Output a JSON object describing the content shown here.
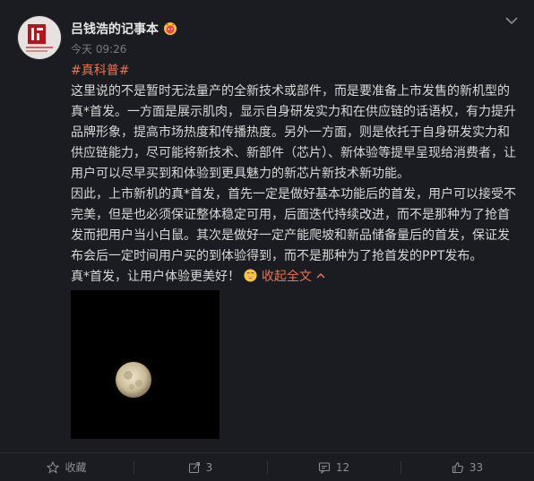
{
  "post": {
    "author": "吕钱浩的记事本",
    "time": "今天 09:26",
    "hashtag": "#真科普#",
    "paragraph1": "这里说的不是暂时无法量产的全新技术或部件，而是要准备上市发售的新机型的真*首发。一方面是展示肌肉，显示自身研发实力和在供应链的话语权，有力提升品牌形象，提高市场热度和传播热度。另外一方面，则是依托于自身研发实力和供应链能力，尽可能将新技术、新部件（芯片）、新体验等提早呈现给消费者，让用户可以尽早买到和体验到更具魅力的新芯片新技术新功能。",
    "paragraph2": "因此，上市新机的真*首发，首先一定是做好基本功能后的首发，用户可以接受不完美，但是也必须保证整体稳定可用，后面迭代持续改进，而不是那种为了抢首发而把用户当小白鼠。其次是做好一定产能爬坡和新品储备量后的首发，保证发布会后一定时间用户买的到体验得到，而不是那种为了抢首发的PPT发布。",
    "paragraph3": "真*首发，让用户体验更美好！",
    "collapse_label": "收起全文"
  },
  "icons": {
    "vip_badge": "vip-badge-icon",
    "more": "chevron-down-icon",
    "emoji": "grinning-face-emoji",
    "collapse": "chevron-up-icon",
    "favorite": "star-icon",
    "repost": "share-icon",
    "comment": "comment-icon",
    "like": "thumbs-up-icon"
  },
  "footer": {
    "favorite_label": "收藏",
    "repost_count": "3",
    "comment_count": "12",
    "like_count": "33"
  },
  "colors": {
    "background": "#1b1c21",
    "link": "#eb7350",
    "text": "#d8d8d8",
    "muted": "#7a7b80"
  }
}
